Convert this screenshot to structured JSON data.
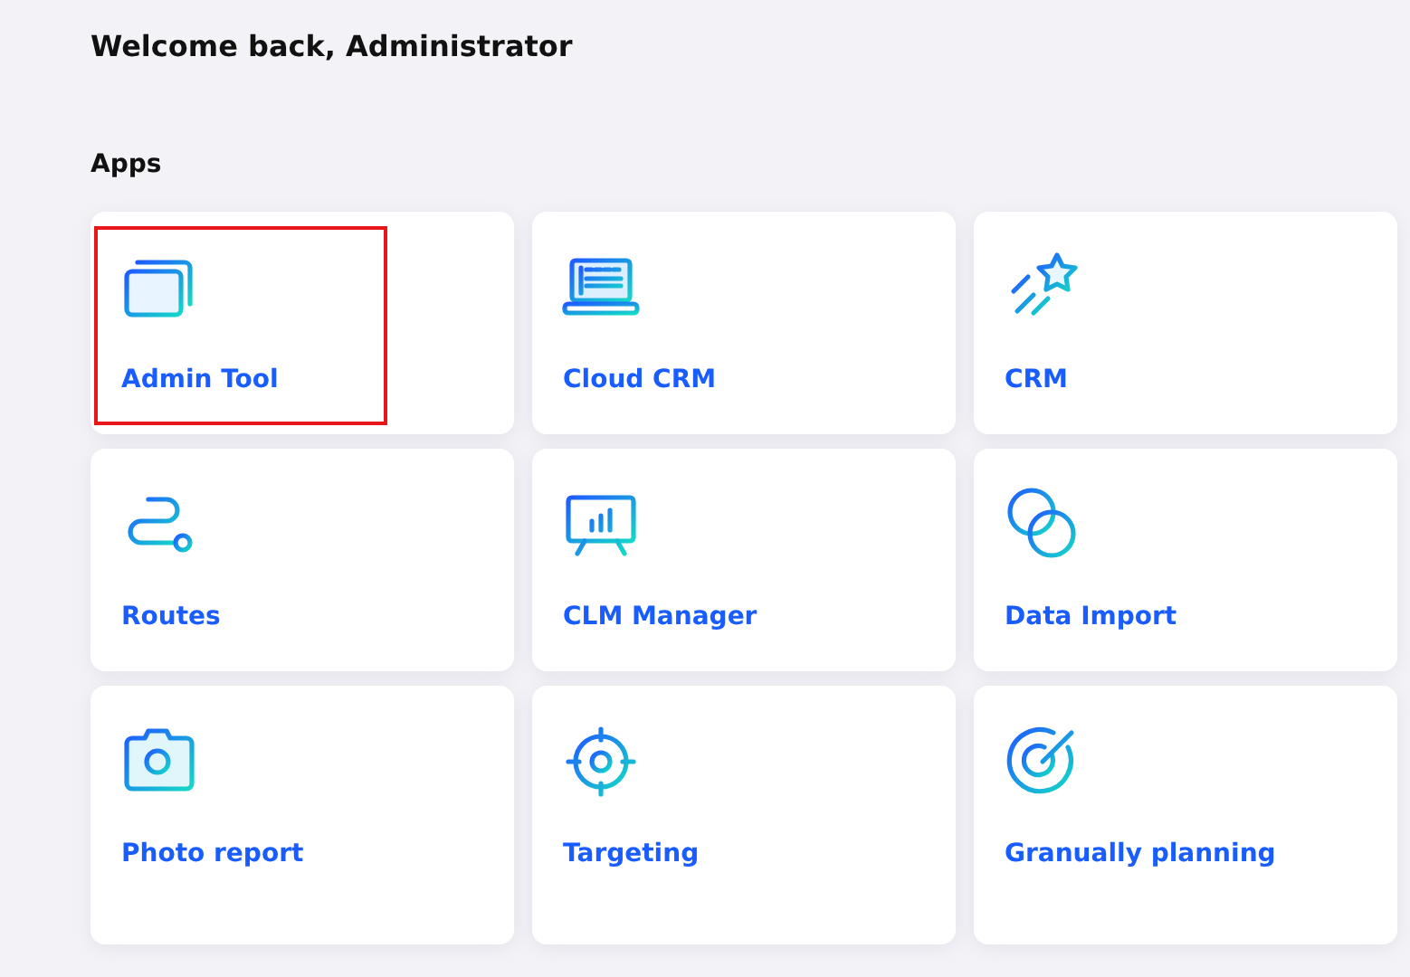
{
  "greeting": "Welcome back, Administrator",
  "section_title": "Apps",
  "apps": [
    {
      "label": "Admin Tool",
      "highlighted": true
    },
    {
      "label": "Cloud CRM",
      "highlighted": false
    },
    {
      "label": "CRM",
      "highlighted": false
    },
    {
      "label": "Routes",
      "highlighted": false
    },
    {
      "label": "CLM Manager",
      "highlighted": false
    },
    {
      "label": "Data Import",
      "highlighted": false
    },
    {
      "label": "Photo report",
      "highlighted": false
    },
    {
      "label": "Targeting",
      "highlighted": false
    },
    {
      "label": "Granually planning",
      "highlighted": false
    }
  ]
}
